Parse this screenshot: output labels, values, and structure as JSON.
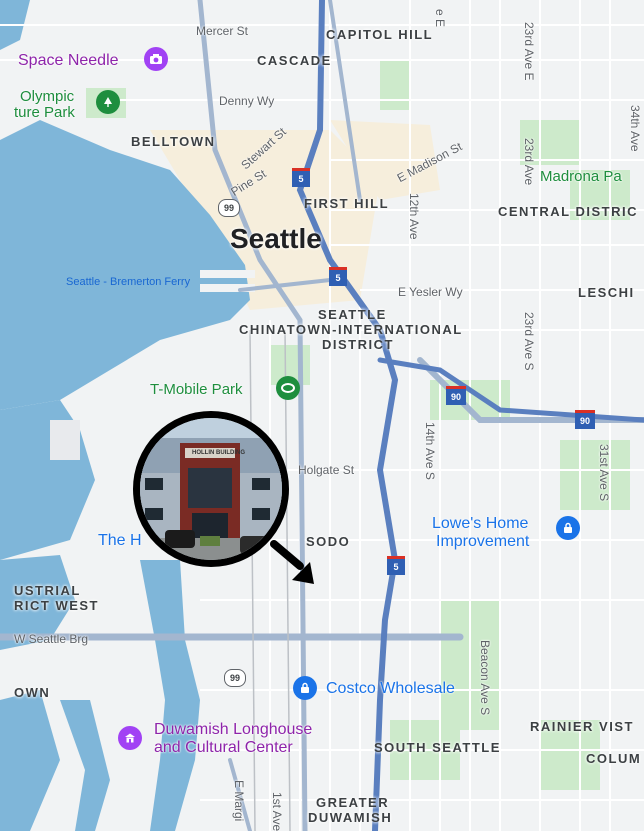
{
  "map": {
    "city": "Seattle",
    "streets": {
      "mercer": "Mercer St",
      "denny": "Denny Wy",
      "stewart": "Stewart St",
      "pine": "Pine St",
      "e_madison": "E Madison St",
      "twelfth": "12th Ave",
      "e_yesler": "E Yesler Wy",
      "twentythird_top": "23rd Ave E",
      "twentythird_mid": "23rd Ave",
      "twentythird_s": "23rd Ave S",
      "fourteenth_s": "14th Ave S",
      "thirtyfirst_s": "31st Ave S",
      "thirtyfourth": "34th Ave",
      "holgate": "Holgate St",
      "beacon": "Beacon Ave S",
      "w_seattle_brg": "W Seattle Brg",
      "first_ave": "1st Ave",
      "e_marginal": "E Margi",
      "ave_e_top": "e E",
      "ferry": "Seattle - Bremerton Ferry"
    },
    "neighborhoods": {
      "capitol_hill": "CAPITOL HILL",
      "cascade": "CASCADE",
      "belltown": "BELLTOWN",
      "first_hill": "FIRST HILL",
      "central_district": "CENTRAL DISTRIC",
      "leschi": "LESCHI",
      "chinatown_1": "SEATTLE",
      "chinatown_2": "CHINATOWN-INTERNATIONAL",
      "chinatown_3": "DISTRICT",
      "sodo": "SODO",
      "industrial_1": "USTRIAL",
      "industrial_2": "RICT WEST",
      "own": "OWN",
      "south_seattle": "SOUTH SEATTLE",
      "rainier_vista": "RAINIER VIST",
      "columbia": "COLUM",
      "greater_duwamish_1": "GREATER",
      "greater_duwamish_2": "DUWAMISH"
    },
    "pois": {
      "space_needle": "Space Needle",
      "olympic_1": "Olympic",
      "olympic_2": "ture Park",
      "madrona": "Madrona Pa",
      "tmobile": "T-Mobile Park",
      "lowes_1": "Lowe's Home",
      "lowes_2": "Improvement",
      "costco": "Costco Wholesale",
      "duwamish_1": "Duwamish Longhouse",
      "duwamish_2": "and Cultural Center",
      "the_h": "The H"
    },
    "shields": {
      "i5_a": "5",
      "i5_b": "5",
      "i5_c": "5",
      "i90_a": "90",
      "i90_b": "90",
      "sr99_a": "99",
      "sr99_b": "99"
    },
    "magnifier": {
      "building_sign": "HOLLIN BUILDING"
    },
    "colors": {
      "water": "#7fb6d9",
      "land": "#f1f3f4",
      "park": "#cdeacb",
      "highway": "#a3b6cf",
      "interstate": "#2f5fb3",
      "magnifier_ring": "#000000"
    }
  }
}
